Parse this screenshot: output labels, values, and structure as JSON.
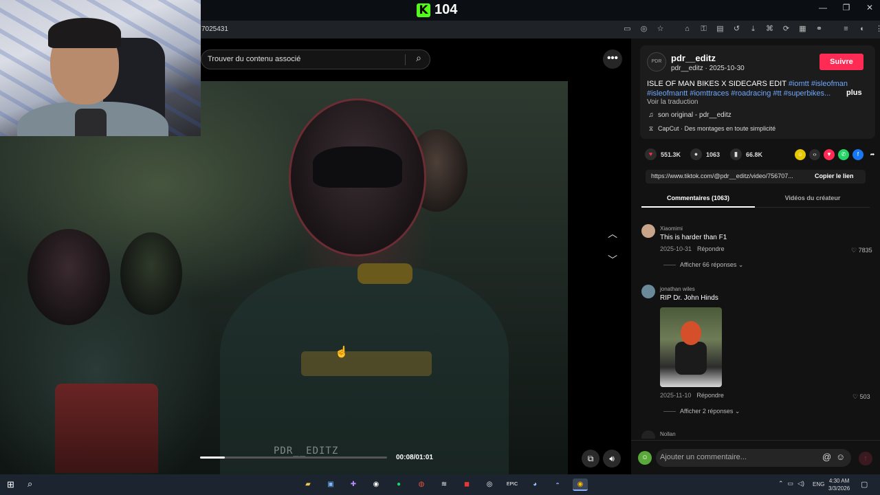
{
  "kick": {
    "count": "104"
  },
  "window_controls": {
    "minimize": "—",
    "restore": "❐",
    "close": "✕"
  },
  "address_bar": {
    "url_fragment": "7025431"
  },
  "video": {
    "search_placeholder": "Trouver du contenu associé",
    "watermark": "PDR__EDITZ",
    "time": "00:08/01:01",
    "progress_fraction": 0.131
  },
  "creator": {
    "username": "pdr__editz",
    "handle_date": "pdr__editz · 2025-10-30",
    "follow_label": "Suivre",
    "description": "ISLE OF MAN BIKES X SIDECARS EDIT",
    "hashtags_line1": "#iomtt #isleofman",
    "hashtags_line2": "#isleofmantt #iomttraces #roadracing #tt #superbikes...",
    "more_label": "plus",
    "translate_label": "Voir la traduction",
    "sound": "son original - pdr__editz",
    "capcut": "CapCut · Des montages en toute simplicité"
  },
  "stats": {
    "likes": "551.3K",
    "comments": "1063",
    "saves": "66.8K"
  },
  "link": {
    "url": "https://www.tiktok.com/@pdr__editz/video/756707...",
    "copy_label": "Copier le lien"
  },
  "tabs": {
    "comments": "Commentaires (1063)",
    "creator_videos": "Vidéos du créateur"
  },
  "comments": [
    {
      "user": "Xiaomimi",
      "text": "This is harder than F1",
      "date": "2025-10-31",
      "reply_label": "Répondre",
      "likes": "7835",
      "replies_label": "Afficher 66 réponses"
    },
    {
      "user": "jonathan wiles",
      "text": "RIP Dr. John Hinds",
      "date": "2025-11-10",
      "reply_label": "Répondre",
      "likes": "503",
      "replies_label": "Afficher 2 réponses"
    },
    {
      "user": "Nollan"
    }
  ],
  "comment_bar": {
    "placeholder": "Ajouter un commentaire..."
  },
  "taskbar": {
    "language": "ENG",
    "time": "4:30 AM",
    "date": "3/3/2026"
  },
  "colors": {
    "accent_follow": "#fe2c55",
    "hashtag": "#6fa8ff",
    "kick_green": "#53fc18"
  }
}
